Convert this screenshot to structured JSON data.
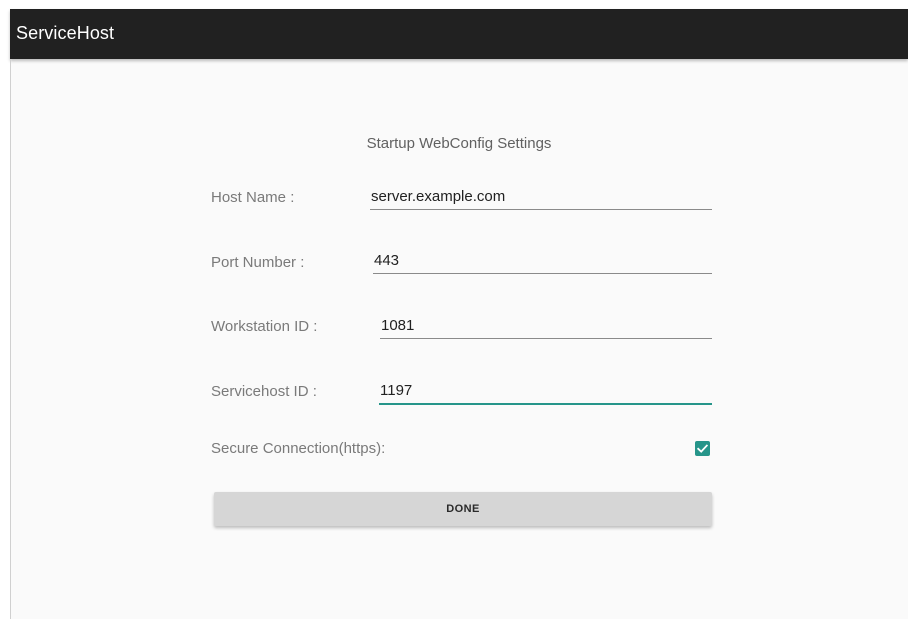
{
  "app": {
    "title": "ServiceHost"
  },
  "form": {
    "heading": "Startup WebConfig Settings",
    "host_name": {
      "label": "Host Name :",
      "value": "server.example.com"
    },
    "port_number": {
      "label": "Port Number :",
      "value": "443"
    },
    "workstation_id": {
      "label": "Workstation ID :",
      "value": "1081"
    },
    "servicehost_id": {
      "label": "Servicehost ID :",
      "value": "1197"
    },
    "secure_connection": {
      "label": "Secure Connection(https):",
      "checked": true
    },
    "done_label": "DONE"
  },
  "colors": {
    "appbar": "#212121",
    "accent": "#26958a",
    "background": "#fafafa",
    "button": "#d6d6d6"
  }
}
